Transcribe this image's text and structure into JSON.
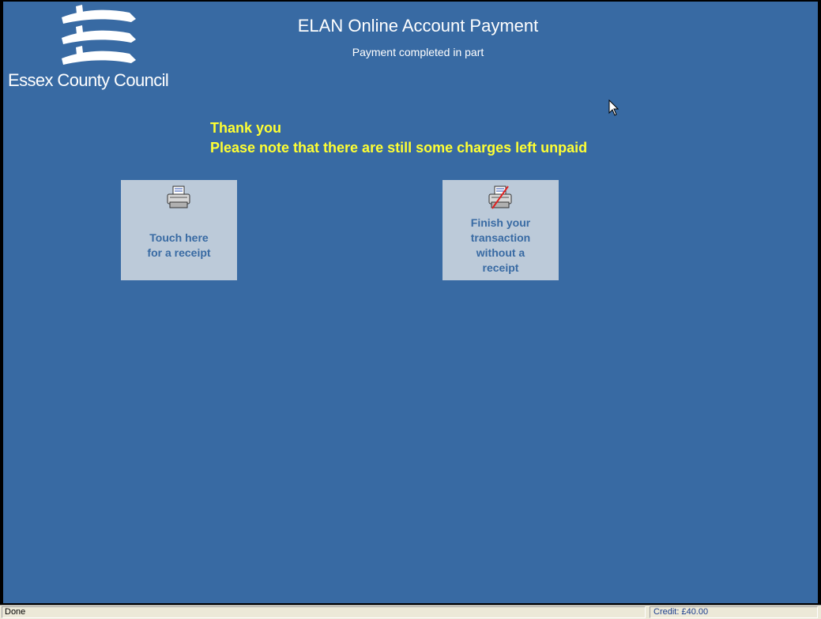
{
  "header": {
    "logo_text": "Essex County Council",
    "logo_icon": "three-seaxes-icon",
    "title": "ELAN Online Account Payment",
    "subtitle": "Payment completed in part"
  },
  "message": {
    "line1": "Thank you",
    "line2": "Please note that there are still some charges left unpaid",
    "color": "#ffff33"
  },
  "actions": {
    "receipt": {
      "label": "Touch here\nfor a receipt",
      "icon": "printer-icon"
    },
    "no_receipt": {
      "label": "Finish your\ntransaction\nwithout a\nreceipt",
      "icon": "printer-crossed-icon"
    }
  },
  "statusbar": {
    "left": "Done",
    "right": "Credit: £40.00"
  },
  "colors": {
    "background": "#386aa3",
    "tile": "#bccad9",
    "tile_text": "#386aa3"
  }
}
